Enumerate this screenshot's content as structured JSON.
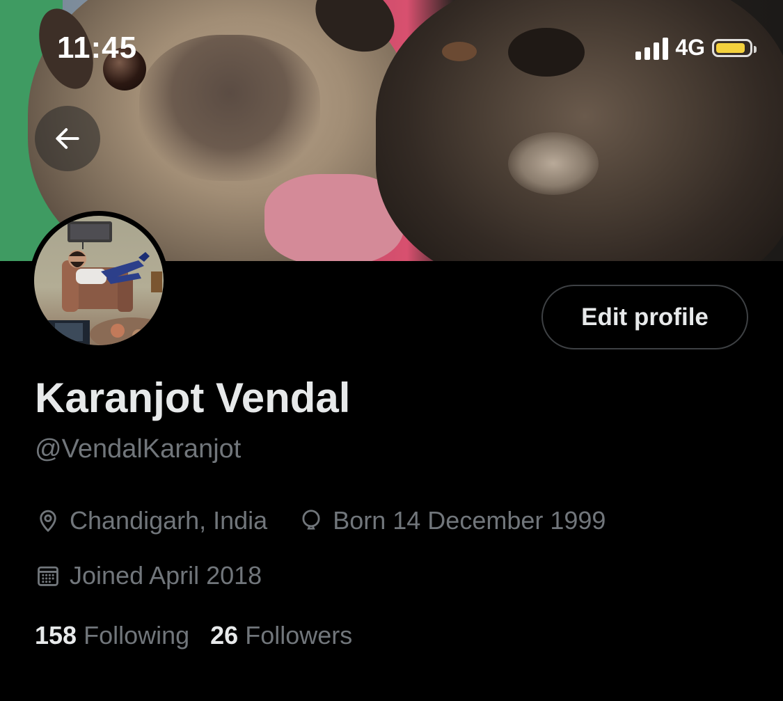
{
  "status_bar": {
    "time": "11:45",
    "network": "4G",
    "battery_level": 0.9,
    "battery_color": "#f4d13d"
  },
  "header": {
    "back_icon": "arrow-left-icon"
  },
  "profile": {
    "edit_button_label": "Edit profile",
    "display_name": "Karanjot Vendal",
    "handle": "@VendalKaranjot",
    "location": "Chandigarh, India",
    "location_icon": "location-pin-icon",
    "birthday": "Born 14 December 1999",
    "birthday_icon": "balloon-icon",
    "joined": "Joined April 2018",
    "joined_icon": "calendar-icon",
    "following_count": "158",
    "following_label": "Following",
    "followers_count": "26",
    "followers_label": "Followers"
  },
  "colors": {
    "background": "#000000",
    "primary_text": "#e7e9ea",
    "secondary_text": "#71767b",
    "button_border": "#3e4144"
  }
}
